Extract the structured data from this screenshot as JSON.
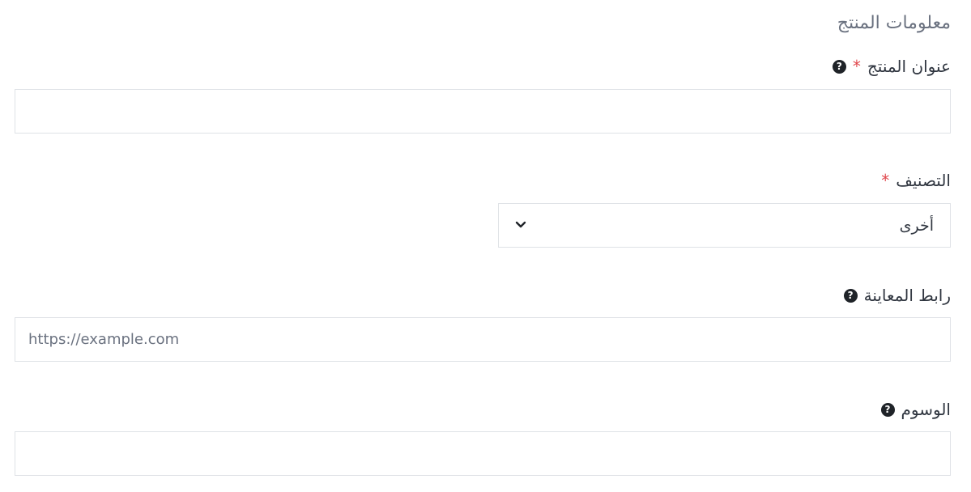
{
  "section": {
    "title": "معلومات المنتج"
  },
  "fields": {
    "product_title": {
      "label": "عنوان المنتج",
      "required_mark": "*",
      "value": "",
      "placeholder": ""
    },
    "category": {
      "label": "التصنيف",
      "required_mark": "*",
      "selected": "أخرى"
    },
    "preview_link": {
      "label": "رابط المعاينة",
      "value": "",
      "placeholder": "https://example.com"
    },
    "tags": {
      "label": "الوسوم",
      "value": "",
      "placeholder": ""
    }
  },
  "icons": {
    "help": "question-circle-icon",
    "dropdown": "chevron-down-icon"
  },
  "colors": {
    "required": "#e0474c",
    "border": "#dfe2e6",
    "text": "#303640",
    "muted": "#6b7280"
  }
}
